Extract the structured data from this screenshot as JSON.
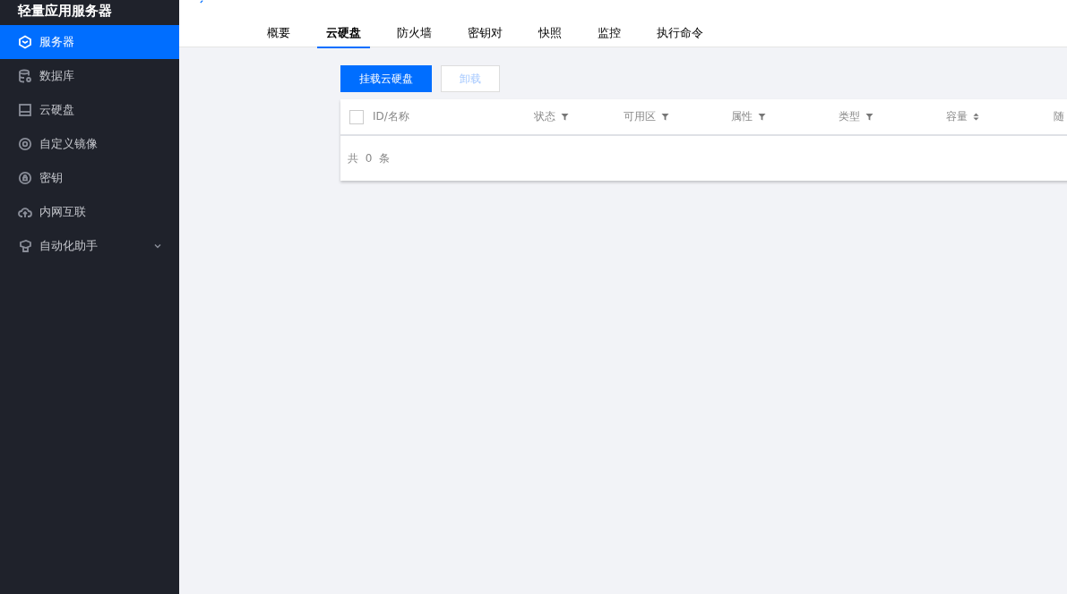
{
  "sidebar": {
    "title": "轻量应用服务器",
    "items": [
      {
        "label": "服务器",
        "kind": "cube",
        "selected": true
      },
      {
        "label": "数据库",
        "kind": "database",
        "selected": false
      },
      {
        "label": "云硬盘",
        "kind": "disk",
        "selected": false
      },
      {
        "label": "自定义镜像",
        "kind": "target",
        "selected": false
      },
      {
        "label": "密钥",
        "kind": "lock",
        "selected": false
      },
      {
        "label": "内网互联",
        "kind": "cloud",
        "selected": false
      },
      {
        "label": "自动化助手",
        "kind": "robot",
        "selected": false,
        "expandable": true
      }
    ]
  },
  "tabs": [
    {
      "label": "概要",
      "selected": false
    },
    {
      "label": "云硬盘",
      "selected": true
    },
    {
      "label": "防火墙",
      "selected": false
    },
    {
      "label": "密钥对",
      "selected": false
    },
    {
      "label": "快照",
      "selected": false
    },
    {
      "label": "监控",
      "selected": false
    },
    {
      "label": "执行命令",
      "selected": false
    }
  ],
  "buttons": [
    {
      "label": "挂载云硬盘",
      "disabled": false
    },
    {
      "label": "卸载",
      "disabled": true
    }
  ],
  "table": {
    "select_all": {
      "checked": false
    },
    "columns": [
      {
        "label": "ID/名称",
        "kind": "plain"
      },
      {
        "label": "状态",
        "kind": "filter"
      },
      {
        "label": "可用区",
        "kind": "filter"
      },
      {
        "label": "属性",
        "kind": "filter"
      },
      {
        "label": "类型",
        "kind": "filter"
      },
      {
        "label": "容量",
        "kind": "sort"
      },
      {
        "label": "随",
        "kind": "plain"
      }
    ],
    "footer": "共 0 条"
  }
}
